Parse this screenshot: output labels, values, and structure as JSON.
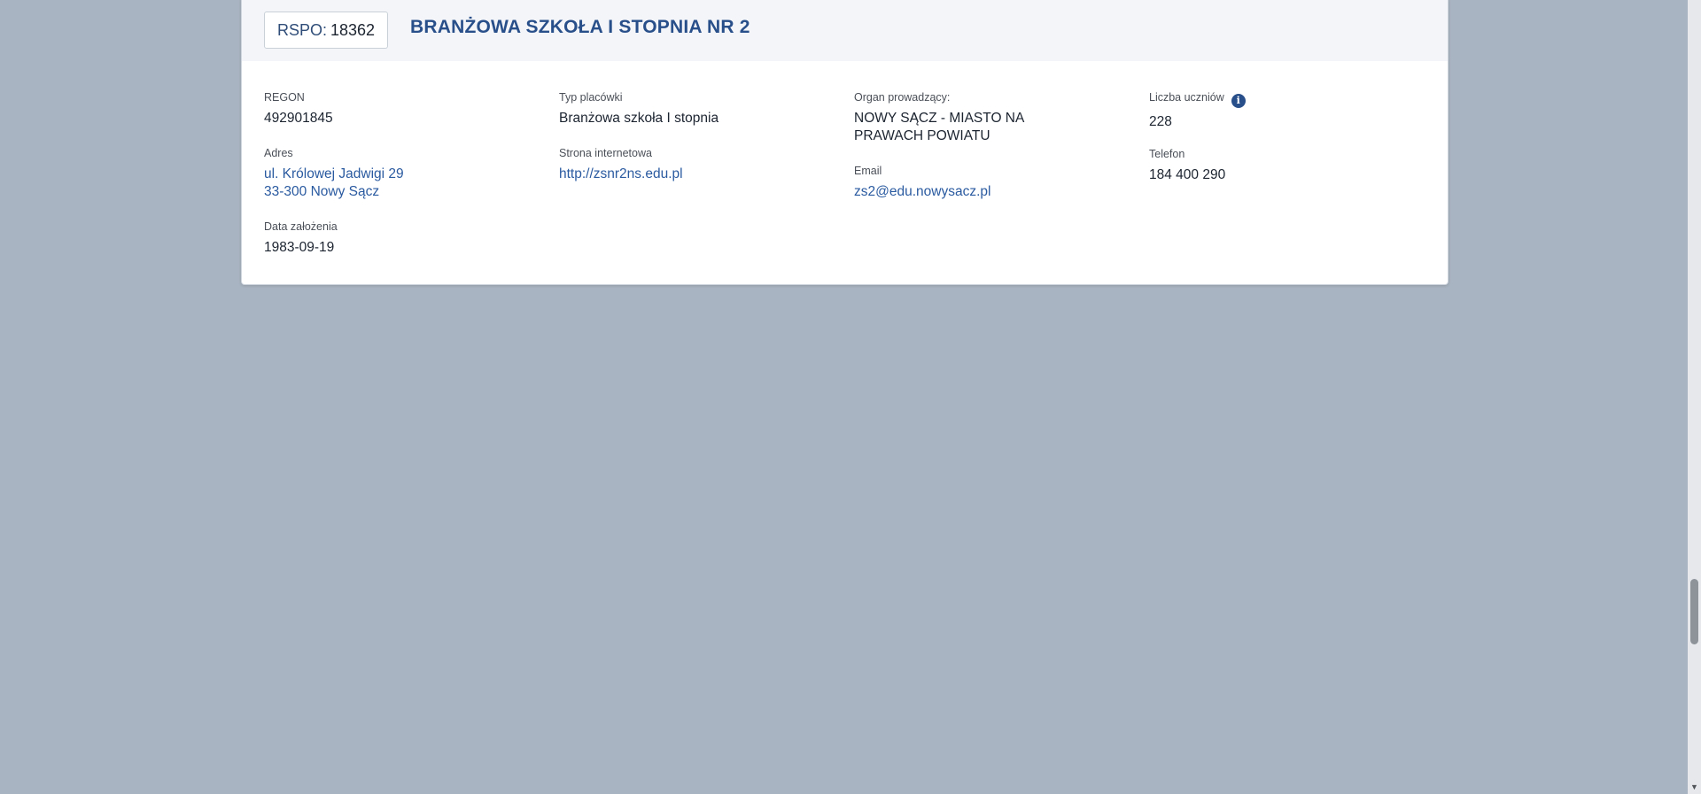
{
  "header": {
    "rspo_label": "RSPO:",
    "rspo_value": "18362",
    "school_name": "BRANŻOWA SZKOŁA I STOPNIA NR 2"
  },
  "details": {
    "regon": {
      "label": "REGON",
      "value": "492901845"
    },
    "adres": {
      "label": "Adres",
      "line1": "ul. Królowej Jadwigi 29",
      "line2": "33-300 Nowy Sącz"
    },
    "data_zalozenia": {
      "label": "Data założenia",
      "value": "1983-09-19"
    },
    "typ_placowki": {
      "label": "Typ placówki",
      "value": "Branżowa szkoła I stopnia"
    },
    "strona": {
      "label": "Strona internetowa",
      "value": "http://zsnr2ns.edu.pl"
    },
    "organ": {
      "label": "Organ prowadzący:",
      "value": "NOWY SĄCZ - MIASTO NA PRAWACH POWIATU"
    },
    "email": {
      "label": "Email",
      "value": "zs2@edu.nowysacz.pl"
    },
    "liczba_uczniow": {
      "label": "Liczba uczniów",
      "value": "228",
      "info_icon": "info-icon"
    },
    "telefon": {
      "label": "Telefon",
      "value": "184 400 290"
    }
  },
  "colors": {
    "page_background": "#a9b4c2",
    "title": "#294f8a",
    "link": "#2a5aa0"
  }
}
